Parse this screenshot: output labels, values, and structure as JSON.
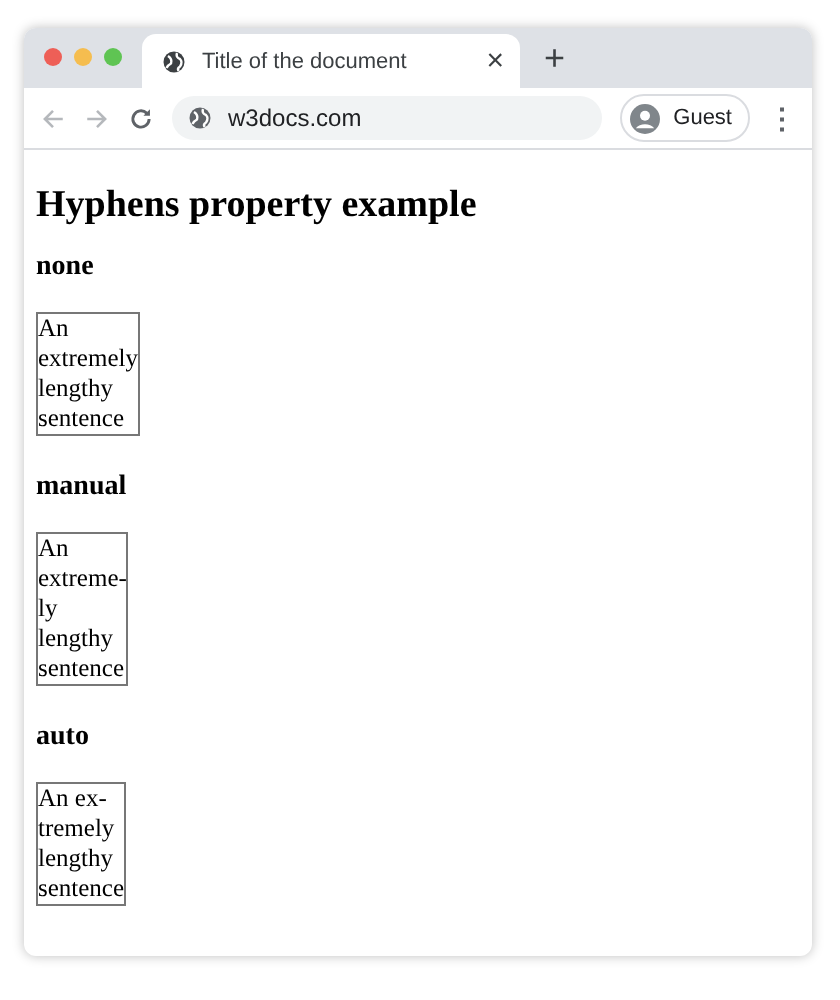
{
  "tab": {
    "title": "Title of the document",
    "close": "×"
  },
  "new_tab": "+",
  "address": "w3docs.com",
  "profile": "Guest",
  "menu": "⋮",
  "heading": "Hyphens property example",
  "examples": [
    {
      "title": "none",
      "lines": [
        "An",
        "extremely",
        "lengthy",
        "sentence"
      ]
    },
    {
      "title": "manual",
      "lines": [
        "An",
        "extreme-",
        "ly",
        "lengthy",
        "sentence"
      ]
    },
    {
      "title": "auto",
      "lines": [
        "An ex-",
        "tremely",
        "lengthy",
        "sentence"
      ]
    }
  ]
}
